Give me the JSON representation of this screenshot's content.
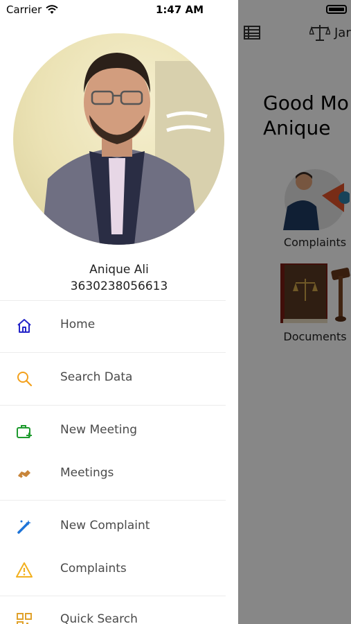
{
  "status_bar": {
    "carrier": "Carrier",
    "time": "1:47 AM"
  },
  "profile": {
    "name": "Anique Ali",
    "id_number": "3630238056613"
  },
  "menu": {
    "items": [
      {
        "label": "Home",
        "icon": "home-icon",
        "color": "#2323c8"
      },
      {
        "label": "Search Data",
        "icon": "search-icon",
        "color": "#f3a01b"
      },
      {
        "label": "New Meeting",
        "icon": "briefcase-plus-icon",
        "color": "#1e9a2e"
      },
      {
        "label": "Meetings",
        "icon": "handshake-icon",
        "color": "#c8853a"
      },
      {
        "label": "New Complaint",
        "icon": "magic-wand-icon",
        "color": "#1d73d8"
      },
      {
        "label": "Complaints",
        "icon": "warning-icon",
        "color": "#f2b01e"
      },
      {
        "label": "Quick Search",
        "icon": "qr-code-icon",
        "color": "#e0a12a"
      }
    ]
  },
  "background_app": {
    "title": "Jar",
    "greeting_line1": "Good Mo",
    "greeting_line2": "Anique",
    "tiles": [
      {
        "label": "Complaints",
        "icon": "megaphone-icon"
      },
      {
        "label": "Documents",
        "icon": "law-book-icon"
      }
    ]
  }
}
